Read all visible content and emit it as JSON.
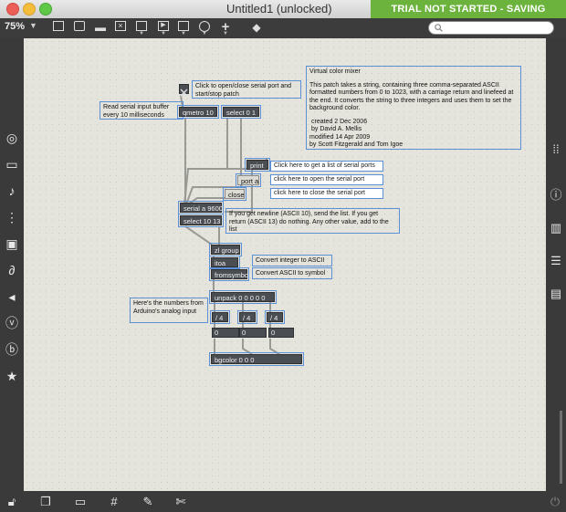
{
  "window": {
    "title": "Untitled1 (unlocked)",
    "trial_banner": "TRIAL NOT STARTED - SAVING DISABLED"
  },
  "toolbar": {
    "zoom": "75%",
    "search_placeholder": ""
  },
  "patch": {
    "objects": {
      "qmetro": "qmetro 10",
      "select01": "select 0 1",
      "print": "print",
      "port_a": "port a",
      "close": "close",
      "serial": "serial a 9600",
      "select1013": "select 10 13",
      "zl_group": "zl group",
      "itoa": "itoa",
      "fromsymbol": "fromsymbol",
      "unpack": "unpack 0 0 0 0 0",
      "div1": "/ 4",
      "div2": "/ 4",
      "div3": "/ 4",
      "num1": "0",
      "num2": "0",
      "num3": "0",
      "bgcolor": "bgcolor 0 0 0"
    },
    "comments": {
      "toggle_hint": "Click to open/close serial port and start/stop patch",
      "read_buffer": "Read serial input buffer every 10 milliseconds",
      "info_title": "Virtual color mixer",
      "info_body": "This patch takes a string, containing three comma-separated ASCII formatted numbers from 0 to 1023, with a carriage return and linefeed at the end.  It converts the string to three integers and uses them to set the background color.",
      "info_created": "created 2 Dec 2006",
      "info_by": "by David A. Mellis",
      "info_modified": "modified 14 Apr 2009",
      "info_by2": "by Scott Fitzgerald and Tom Igoe",
      "newline_note": "If you get newline (ASCII 10), send the list. If you get return (ASCII 13) do nothing. Any other value, add to the list",
      "convert_int": "Convert integer to ASCII",
      "convert_ascii": "Convert ASCII to symbol",
      "arduino_note": "Here's the numbers from Arduino's analog input"
    },
    "messages": {
      "list_ports": "Click here to get a list of serial ports",
      "open_port": "click here to open the serial port",
      "close_port": "click here to close the serial port"
    }
  },
  "sidebar_left": [
    "target-icon",
    "keyboard-icon",
    "music-note-icon",
    "sliders-icon",
    "image-icon",
    "paperclip-icon",
    "plug-icon",
    "v-circle-icon",
    "b-circle-icon",
    "star-icon"
  ],
  "sidebar_right": [
    "grid-dots-icon",
    "info-icon",
    "book-icon",
    "list-icon",
    "book-open-icon"
  ],
  "bottombar": [
    "lock-icon",
    "windows-icon",
    "presentation-icon",
    "grid-icon",
    "wand-icon",
    "wrench-icon",
    "power-icon"
  ]
}
